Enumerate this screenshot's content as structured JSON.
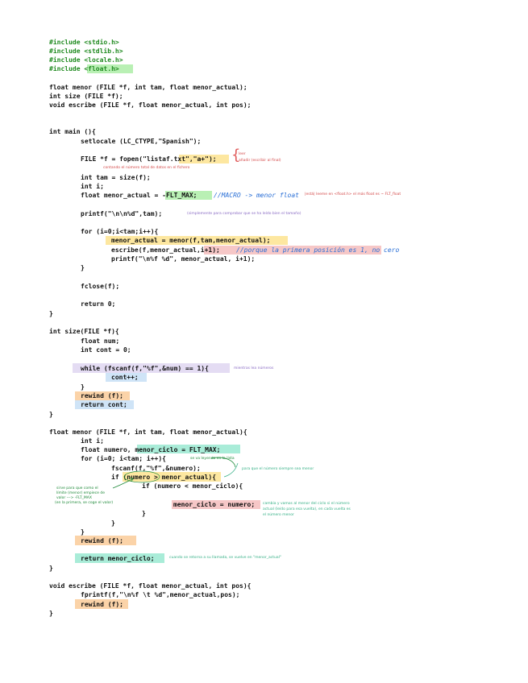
{
  "code_lines": [
    "#include <stdio.h>",
    "#include <stdlib.h>",
    "#include <locale.h>",
    "#include <float.h>",
    "float menor (FILE *f, int tam, float menor_actual);",
    "int size (FILE *f);",
    "void escribe (FILE *f, float menor_actual, int pos);",
    "int main (){",
    "setlocale (LC_CTYPE,\"Spanish\");",
    "FILE *f = fopen(\"listaf.txt\",\"a+\");",
    "int tam = size(f);",
    "int i;",
    "float menor_actual = -FLT_MAX;",
    "//MACRO -> menor float",
    "printf(\"\\n\\n%d\",tam);",
    "for (i=0;i<tam;i++){",
    "menor_actual = menor(f,tam,menor_actual);",
    "escribe(f,menor_actual,i+1);",
    "//porque la primera posición es 1, no cero",
    "printf(\"\\n%f %d\", menor_actual, i+1);",
    "}",
    "fclose(f);",
    "return 0;",
    "}",
    "int size(FILE *f){",
    "float num;",
    "int cont = 0;",
    "while (fscanf(f,\"%f\",&num) == 1){",
    "cont++;",
    "}",
    "rewind (f);",
    "return cont;",
    "}",
    "float menor (FILE *f, int tam, float menor_actual){",
    "int i;",
    "float numero, menor_ciclo = FLT_MAX;",
    "for (i=0; i<tam; i++){",
    "fscanf(f,\"%f\",&numero);",
    "if (numero > menor_actual){",
    "if (numero < menor_ciclo){",
    "menor_ciclo = numero;",
    "}",
    "}",
    "}",
    "rewind (f);",
    "return menor_ciclo;",
    "}",
    "void escribe (FILE *f, float menor_actual, int pos){",
    "fprintf(f,\"\\n%f \\t %d\",menor_actual,pos);",
    "rewind (f);",
    "}"
  ],
  "notes": {
    "fopen_a": "leer",
    "fopen_b": "añadir (escribir al final)",
    "size_note": "contando el número total de datos en el fichero",
    "macro_note": "|está| leeme en <float.h> el más float es ~ FLT_float",
    "printf_note": "(simplemente para comprobar que se ha leído bien el tamaño)",
    "while_note": "mientras lea números",
    "ciclo_note": "para que el número siempre sea menor",
    "numero_note": "se va leyendo en la lista",
    "left_note_1": "sirve para que como el",
    "left_note_2": "límite (menor) empiece de",
    "left_note_3": "valor ---> -FLT_MAX",
    "left_note_4": "(en la primera, se coge el valor)",
    "menor_note_1": "cambia y vamos al menor del ciclo si el número",
    "menor_note_2": "actual (leído para esa vuelta), en cada vuelta es",
    "menor_note_3": "el número menor",
    "return_note": "cuando se retorna a su llamada, se vuelve en \"menor_actual\""
  },
  "colors": {
    "include": "#1f8a1f",
    "string": "#d11a1a",
    "comment": "#2a6fd6",
    "hl_green": "#b9f0b4",
    "hl_yellow": "#fde7a0",
    "hl_red": "#f6c7c7",
    "hl_purple": "#e4dcf3",
    "hl_blue": "#cfe4f7",
    "hl_orange": "#fbd3a8",
    "hl_teal": "#a9ecd8"
  }
}
